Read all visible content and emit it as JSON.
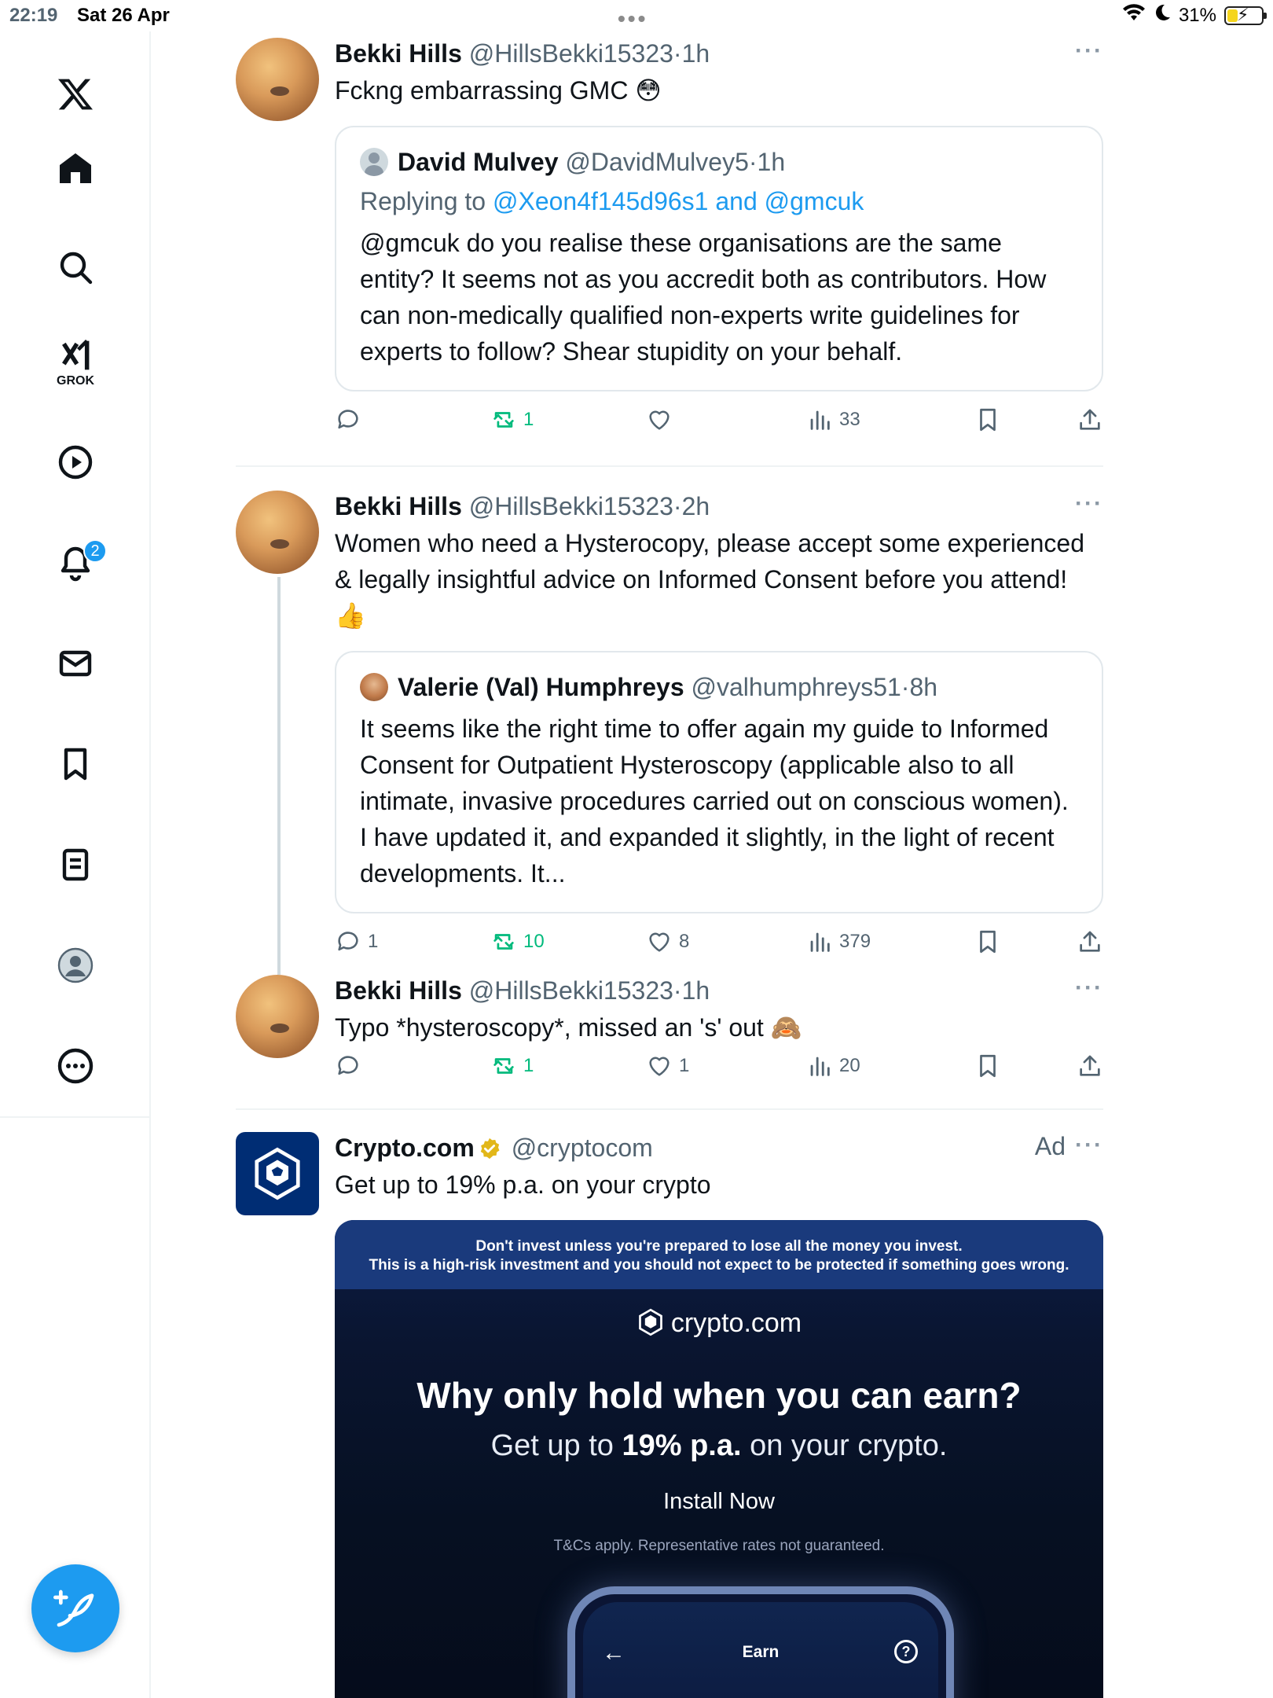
{
  "status_bar": {
    "time": "22:19",
    "date": "Sat 26 Apr",
    "battery": "31%",
    "battery_level": 0.31,
    "top_dots": "•••"
  },
  "sidebar": {
    "items": [
      {
        "name": "x-logo"
      },
      {
        "name": "home"
      },
      {
        "name": "explore"
      },
      {
        "name": "grok",
        "label": "GROK"
      },
      {
        "name": "video"
      },
      {
        "name": "notifications",
        "badge": "2"
      },
      {
        "name": "messages"
      },
      {
        "name": "bookmarks"
      },
      {
        "name": "lists"
      },
      {
        "name": "profile"
      },
      {
        "name": "more"
      }
    ],
    "compose_icon": "feather-plus-icon"
  },
  "tweets": [
    {
      "name": "Bekki Hills",
      "handle": "@HillsBekki15323",
      "sep": "·",
      "time": "1h",
      "more": "···",
      "text": "Fckng embarrassing GMC 😳",
      "quote": {
        "name": "David Mulvey",
        "handle": "@DavidMulvey5",
        "sep": "·",
        "time": "1h",
        "replying_prefix": "Replying to ",
        "replying_to": "@Xeon4f145d96s1 and @gmcuk",
        "text": "@gmcuk do you realise these organisations are the same entity? It seems not as you accredit both as contributors. How can non-medically qualified non-experts write guidelines for experts to follow? Shear stupidity on your behalf."
      },
      "stats": {
        "replies": "",
        "reposts": "1",
        "likes": "",
        "views": "33"
      }
    },
    {
      "name": "Bekki Hills",
      "handle": "@HillsBekki15323",
      "sep": "·",
      "time": "2h",
      "more": "···",
      "text": "Women who need a Hysterocopy, please accept some experienced & legally insightful advice on Informed Consent before you attend! 👍",
      "quote": {
        "name": "Valerie (Val) Humphreys",
        "handle": "@valhumphreys51",
        "sep": "·",
        "time": "8h",
        "text": "It seems like the right time to offer again my guide to Informed Consent for Outpatient Hysteroscopy (applicable also to all intimate, invasive procedures carried out on conscious women). I have updated it, and expanded it slightly, in the light of recent developments. It..."
      },
      "stats": {
        "replies": "1",
        "reposts": "10",
        "likes": "8",
        "views": "379"
      }
    },
    {
      "name": "Bekki Hills",
      "handle": "@HillsBekki15323",
      "sep": "·",
      "time": "1h",
      "more": "···",
      "text": "Typo *hysteroscopy*, missed an 's' out 🙈",
      "stats": {
        "replies": "",
        "reposts": "1",
        "likes": "1",
        "views": "20"
      }
    }
  ],
  "ad": {
    "name": "Crypto.com",
    "handle": "@cryptocom",
    "ad_label": "Ad",
    "more": "···",
    "text": "Get up to 19% p.a. on your crypto",
    "card": {
      "warning_line1": "Don't invest unless you're prepared to lose all the money you invest.",
      "warning_line2": "This is a high-risk investment and you should not expect to be protected if something goes wrong.",
      "brand": "crypto.com",
      "headline": "Why only hold when you can earn?",
      "sub_prefix": "Get up to ",
      "sub_bold": "19% p.a.",
      "sub_suffix": " on your crypto.",
      "cta": "Install Now",
      "tc": "T&Cs apply. Representative rates not guaranteed.",
      "phone_title": "Earn",
      "phone_back": "←",
      "phone_help": "?"
    }
  },
  "colors": {
    "accent": "#1d9bf0",
    "repost": "#00ba7c",
    "text": "#0f1419",
    "muted": "#536471",
    "ad_bg": "#0a1530",
    "ad_banner": "#1a3a7c"
  }
}
